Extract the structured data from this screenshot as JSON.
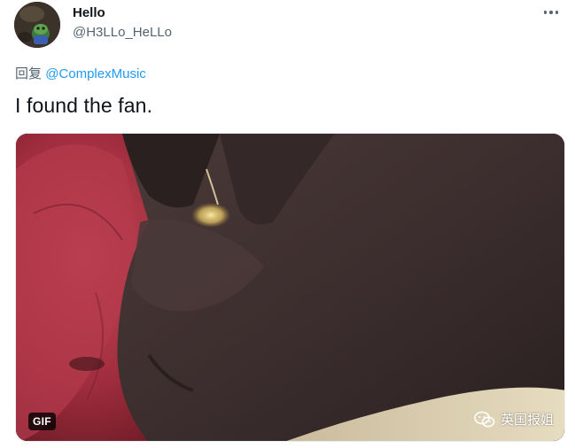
{
  "tweet": {
    "display_name": "Hello",
    "handle": "@H3LLo_HeLLo",
    "reply_prefix": "回复",
    "reply_mention": "@ComplexMusic",
    "text": "I found the fan.",
    "media": {
      "badge": "GIF",
      "watermark_text": "英国报姐",
      "watermark_icon": "wechat-icon"
    },
    "more_icon": "more-horizontal-icon"
  },
  "colors": {
    "text_primary": "#0f1419",
    "text_secondary": "#536471",
    "link": "#1d9bf0"
  }
}
